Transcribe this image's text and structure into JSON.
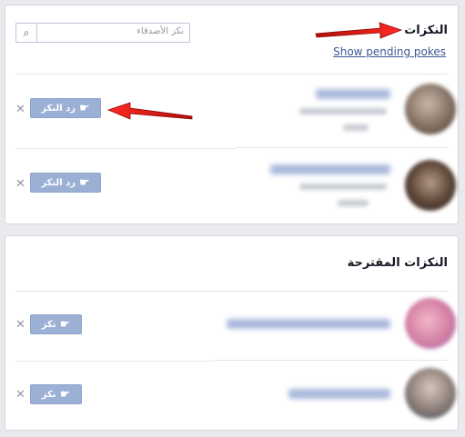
{
  "pokes": {
    "title": "النكزات",
    "pending_link": "Show pending pokes",
    "search_placeholder": "نكز الأصدقاء",
    "search_icon": "magnifier-icon",
    "rows": [
      {
        "button_label": "رد النكز",
        "dismiss": "✕"
      },
      {
        "button_label": "رد النكز",
        "dismiss": "✕"
      }
    ]
  },
  "suggested": {
    "title": "النكزات المقترحة",
    "rows": [
      {
        "button_label": "نكز",
        "dismiss": "✕"
      },
      {
        "button_label": "نكز",
        "dismiss": "✕"
      }
    ]
  },
  "icons": {
    "hand": "☛",
    "search": "⌕"
  },
  "colors": {
    "accent": "#3b5998",
    "button_bg": "#9cb0d6",
    "arrow": "#e0201a"
  }
}
